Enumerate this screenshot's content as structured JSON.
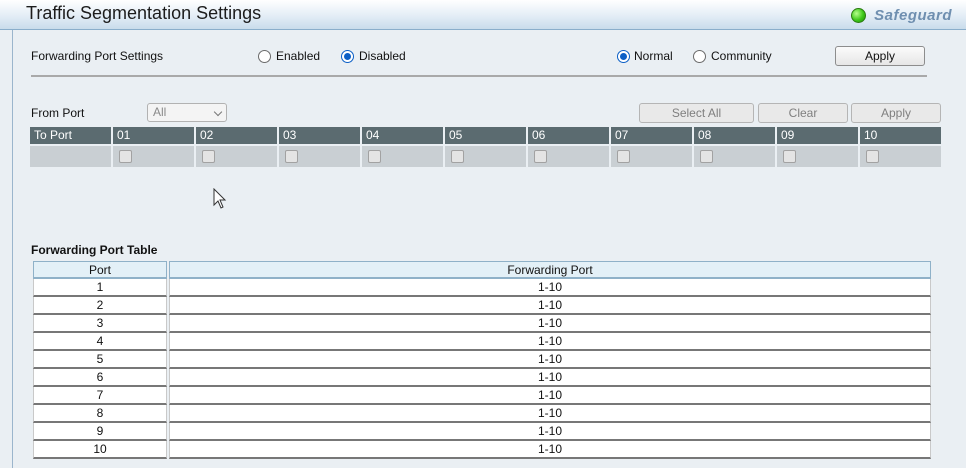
{
  "header": {
    "title": "Traffic Segmentation Settings",
    "safeguard_label": "Safeguard",
    "safeguard_led_color": "#3ec81a"
  },
  "forwarding": {
    "label": "Forwarding Port Settings",
    "enabled_label": "Enabled",
    "disabled_label": "Disabled",
    "selected": "Disabled",
    "normal_label": "Normal",
    "community_label": "Community",
    "mode_selected": "Normal",
    "apply_label": "Apply"
  },
  "from_port": {
    "label": "From Port",
    "selected": "All",
    "select_all_label": "Select All",
    "clear_label": "Clear",
    "apply_label": "Apply"
  },
  "to_port": {
    "label": "To Port",
    "ports": [
      "01",
      "02",
      "03",
      "04",
      "05",
      "06",
      "07",
      "08",
      "09",
      "10"
    ]
  },
  "table": {
    "title": "Forwarding Port Table",
    "headers": [
      "Port",
      "Forwarding Port"
    ],
    "rows": [
      [
        "1",
        "1-10"
      ],
      [
        "2",
        "1-10"
      ],
      [
        "3",
        "1-10"
      ],
      [
        "4",
        "1-10"
      ],
      [
        "5",
        "1-10"
      ],
      [
        "6",
        "1-10"
      ],
      [
        "7",
        "1-10"
      ],
      [
        "8",
        "1-10"
      ],
      [
        "9",
        "1-10"
      ],
      [
        "10",
        "1-10"
      ]
    ]
  }
}
